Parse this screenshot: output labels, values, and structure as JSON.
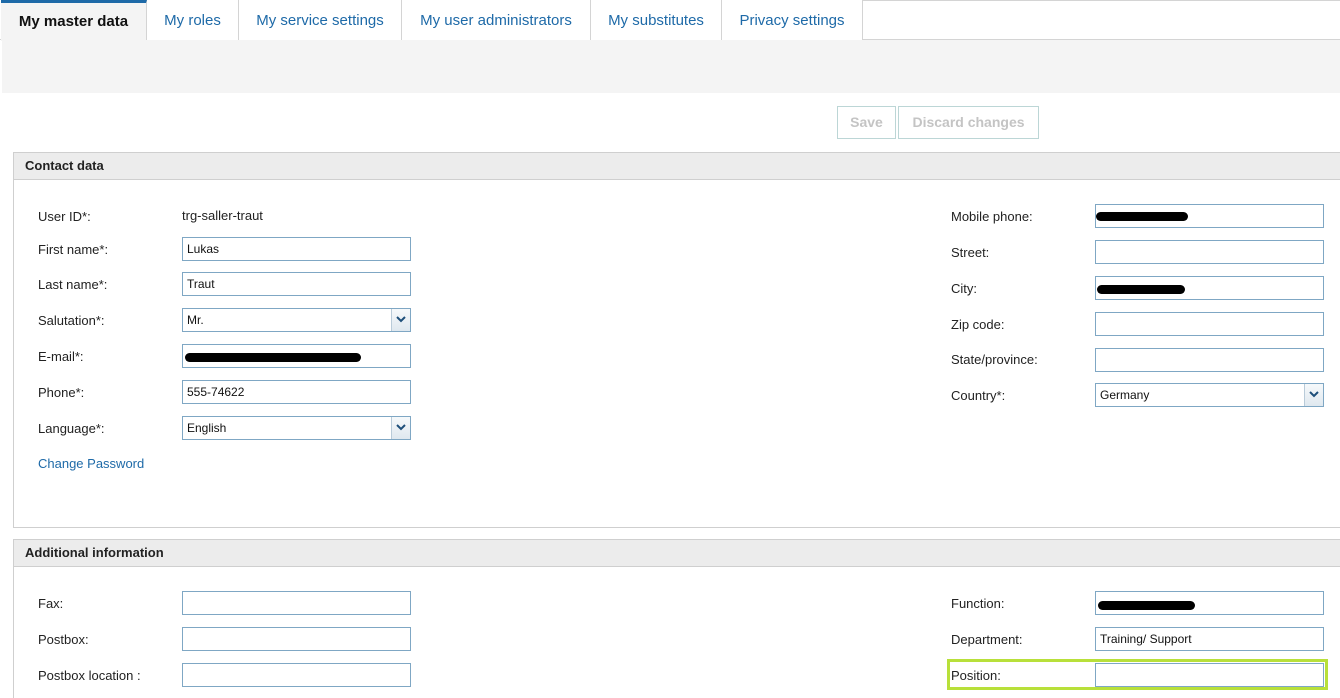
{
  "tabs": [
    {
      "label": "My master data",
      "active": true
    },
    {
      "label": "My roles"
    },
    {
      "label": "My service settings"
    },
    {
      "label": "My user administrators"
    },
    {
      "label": "My substitutes"
    },
    {
      "label": "Privacy settings"
    }
  ],
  "toolbar": {
    "save_label": "Save",
    "discard_label": "Discard changes"
  },
  "contact": {
    "title": "Contact data",
    "user_id_label": "User ID*:",
    "user_id_value": "trg-saller-traut",
    "first_name_label": "First name*:",
    "first_name_value": "Lukas",
    "last_name_label": "Last name*:",
    "last_name_value": "Traut",
    "salutation_label": "Salutation*:",
    "salutation_value": "Mr.",
    "email_label": "E-mail*:",
    "phone_label": "Phone*:",
    "phone_value": "555-74622",
    "language_label": "Language*:",
    "language_value": "English",
    "change_password_label": "Change Password",
    "mobile_label": "Mobile phone:",
    "street_label": "Street:",
    "city_label": "City:",
    "zip_label": "Zip code:",
    "state_label": "State/province:",
    "country_label": "Country*:",
    "country_value": "Germany"
  },
  "additional": {
    "title": "Additional information",
    "fax_label": "Fax:",
    "postbox_label": "Postbox:",
    "postbox_location_label": "Postbox location :",
    "function_label": "Function:",
    "department_label": "Department:",
    "department_value": "Training/ Support",
    "position_label": "Position:"
  },
  "colors": {
    "accent": "#1e6aa8",
    "highlight": "#b8e03a"
  }
}
